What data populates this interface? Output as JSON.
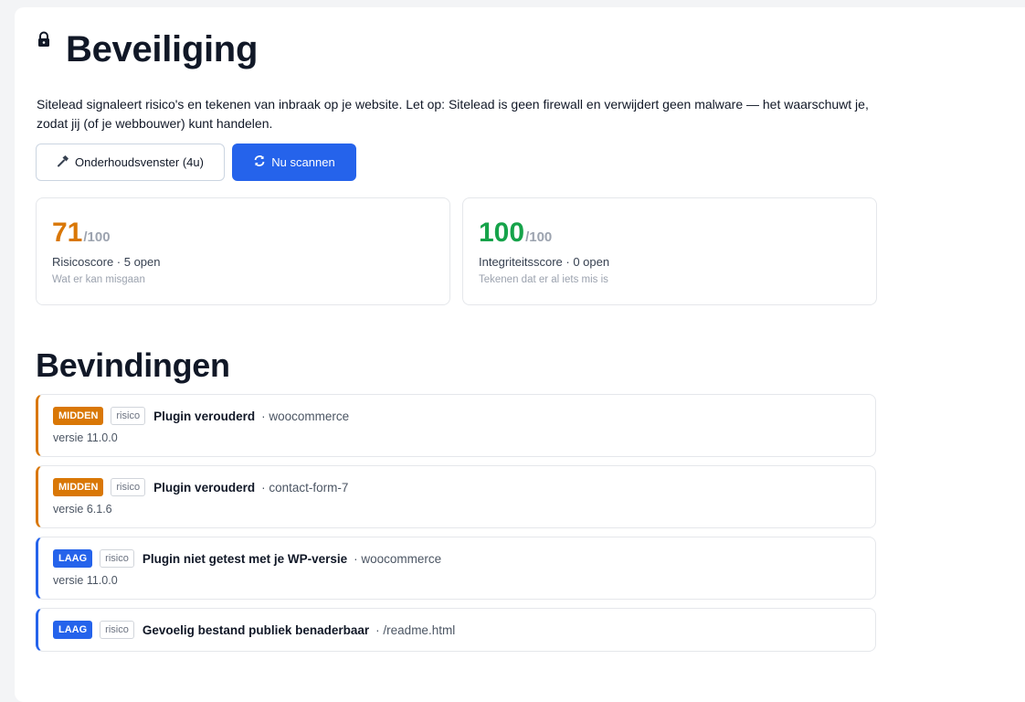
{
  "page": {
    "title": "Beveiliging",
    "description": "Sitelead signaleert risico's en tekenen van inbraak op je website. Let op: Sitelead is geen firewall en verwijdert geen malware — het waarschuwt je, zodat jij (of je webbouwer) kunt handelen."
  },
  "icons": {
    "title": "lock-icon",
    "maintenance": "hammer-icon",
    "scan": "refresh-icon"
  },
  "buttons": {
    "maintenance_label": "Onderhoudsvenster (4u)",
    "scan_label": "Nu scannen"
  },
  "scores": [
    {
      "value": "71",
      "max": "/100",
      "label": "Risicoscore · 5 open",
      "hint": "Wat er kan misgaan",
      "color": "#d97706"
    },
    {
      "value": "100",
      "max": "/100",
      "label": "Integriteitsscore · 0 open",
      "hint": "Tekenen dat er al iets mis is",
      "color": "#16a34a"
    }
  ],
  "findings_title": "Bevindingen",
  "findings": [
    {
      "severity": "MIDDEN",
      "type": "risico",
      "title": "Plugin verouderd",
      "target": "· woocommerce",
      "detail": "versie 11.0.0"
    },
    {
      "severity": "MIDDEN",
      "type": "risico",
      "title": "Plugin verouderd",
      "target": "· contact-form-7",
      "detail": "versie 6.1.6"
    },
    {
      "severity": "LAAG",
      "type": "risico",
      "title": "Plugin niet getest met je WP-versie",
      "target": "· woocommerce",
      "detail": "versie 11.0.0"
    },
    {
      "severity": "LAAG",
      "type": "risico",
      "title": "Gevoelig bestand publiek benaderbaar",
      "target": "· /readme.html",
      "detail": ""
    }
  ],
  "colors": {
    "primary": "#2563eb",
    "medium": "#d97706",
    "good": "#16a34a"
  }
}
